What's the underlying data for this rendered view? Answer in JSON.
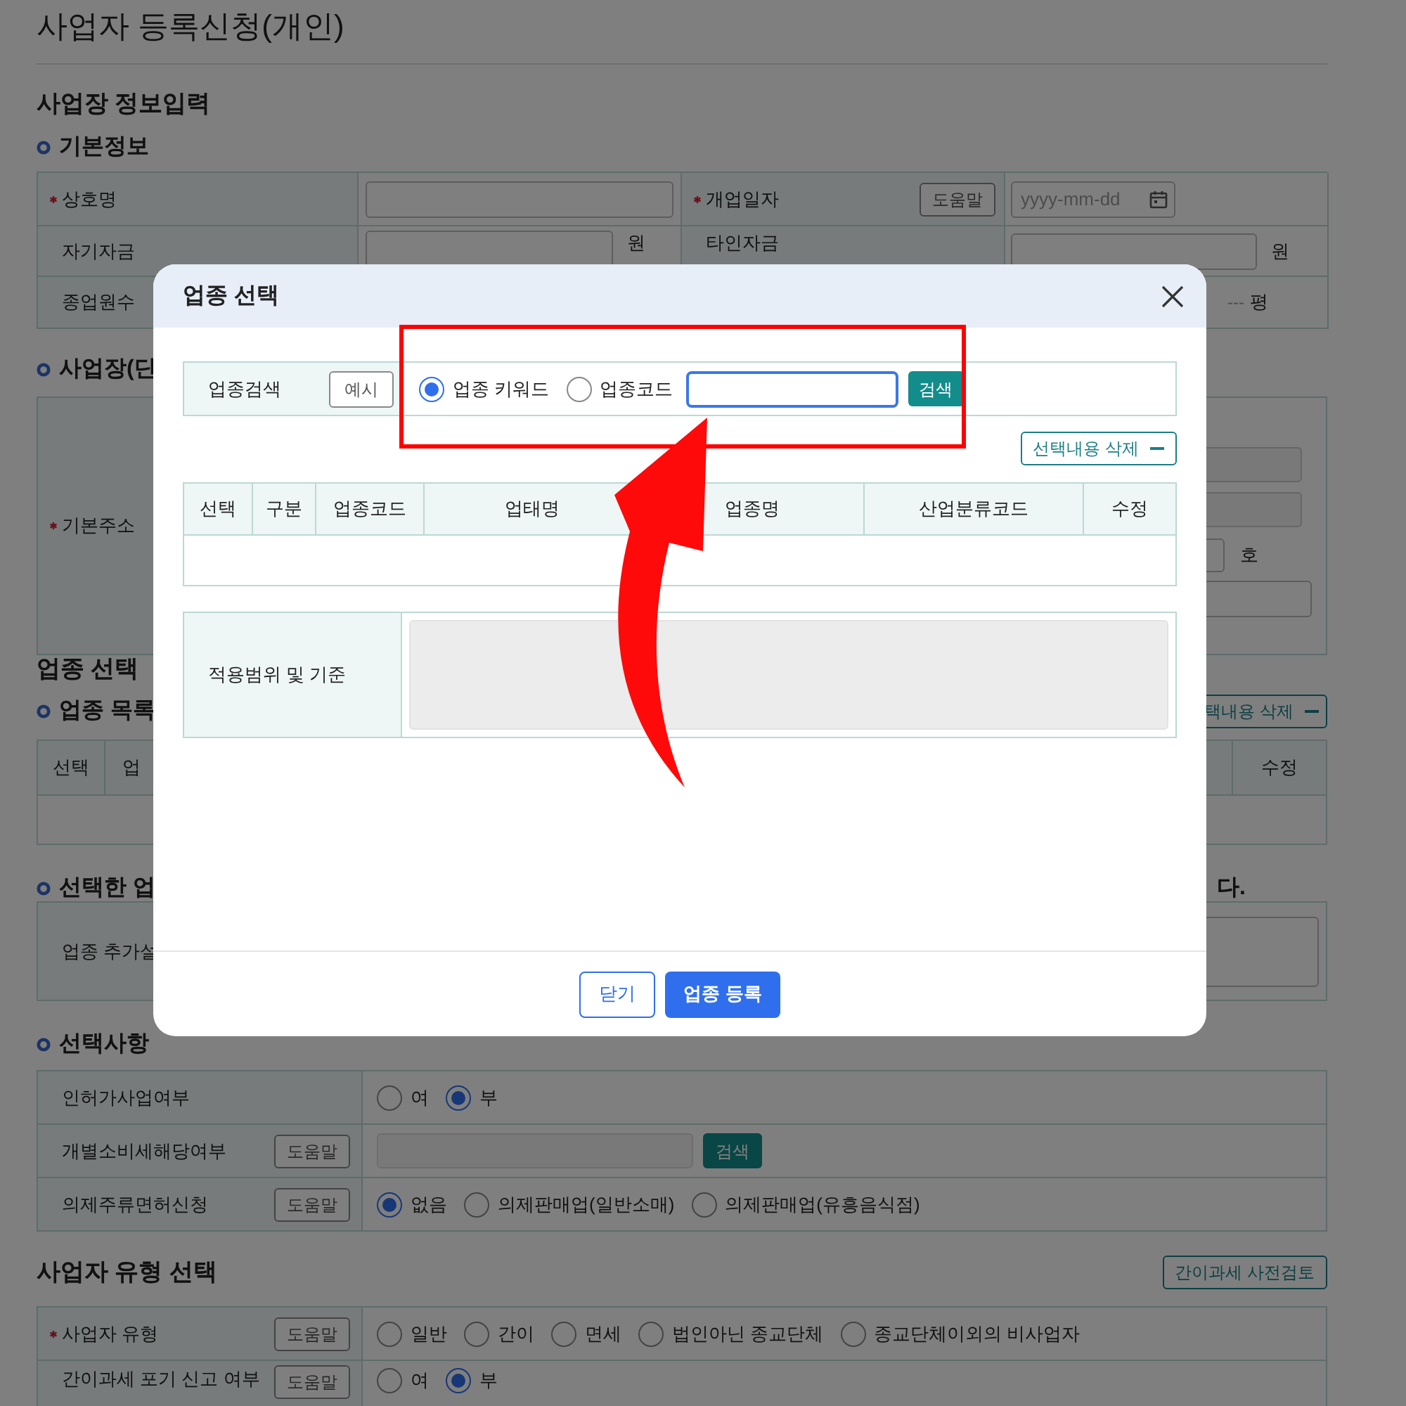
{
  "page_title": "사업자 등록신청(개인)",
  "basic_info": {
    "heading": "사업장 정보입력",
    "subheading": "기본정보",
    "trade_name": {
      "label": "상호명",
      "required": true
    },
    "opening_date": {
      "label": "개업일자",
      "required": true,
      "help_button": "도움말",
      "placeholder": "yyyy-mm-dd"
    },
    "own_capital": {
      "label": "자기자금",
      "unit": "원"
    },
    "other_capital": {
      "label": "타인자금",
      "unit": "원"
    },
    "employees": {
      "label": "종업원수"
    },
    "area": {
      "placeholder": "---",
      "unit": "평"
    }
  },
  "site_address": {
    "subheading": "사업장(단",
    "label": "기본주소",
    "required": true,
    "unit": "호"
  },
  "industry": {
    "heading": "업종 선택",
    "list_heading": "업종 목록",
    "delete_button": "택내용 삭제",
    "columns": [
      "선택",
      "업",
      "수정"
    ],
    "note_start": "선택한 업",
    "note_end": "다.",
    "extra_label": "업종 추가설"
  },
  "options": {
    "heading": "선택사항",
    "rows": [
      {
        "kind": "radio",
        "label": "인허가사업여부",
        "options": [
          {
            "label": "여",
            "selected": false
          },
          {
            "label": "부",
            "selected": true
          }
        ]
      },
      {
        "kind": "search",
        "label": "개별소비세해당여부",
        "help_button": "도움말",
        "search_button": "검색"
      },
      {
        "kind": "radio",
        "label": "의제주류면허신청",
        "help_button": "도움말",
        "options": [
          {
            "label": "없음",
            "selected": true
          },
          {
            "label": "의제판매업(일반소매)",
            "selected": false
          },
          {
            "label": "의제판매업(유흥음식점)",
            "selected": false
          }
        ]
      }
    ]
  },
  "business_type": {
    "heading": "사업자 유형 선택",
    "review_button": "간이과세 사전검토",
    "rows": [
      {
        "kind": "radio",
        "label": "사업자 유형",
        "required": true,
        "help_button": "도움말",
        "options": [
          {
            "label": "일반",
            "selected": false
          },
          {
            "label": "간이",
            "selected": false
          },
          {
            "label": "면세",
            "selected": false
          },
          {
            "label": "법인아닌 종교단체",
            "selected": false
          },
          {
            "label": "종교단체이외의 비사업자",
            "selected": false
          }
        ]
      },
      {
        "kind": "radio",
        "label": "간이과세 포기 신고 여부",
        "help_button": "도움말",
        "options": [
          {
            "label": "여",
            "selected": false
          },
          {
            "label": "부",
            "selected": true
          }
        ]
      }
    ]
  },
  "modal": {
    "title": "업종 선택",
    "search": {
      "label": "업종검색",
      "example_button": "예시",
      "modes": [
        {
          "label": "업종 키워드",
          "selected": true
        },
        {
          "label": "업종코드",
          "selected": false
        }
      ],
      "search_button": "검색"
    },
    "delete_button": "선택내용 삭제",
    "columns": [
      "선택",
      "구분",
      "업종코드",
      "업태명",
      "업종명",
      "산업분류코드",
      "수정"
    ],
    "criteria_label": "적용범위 및 기준",
    "buttons": [
      {
        "label": "닫기",
        "kind": "secondary"
      },
      {
        "label": "업종 등록",
        "kind": "primary"
      }
    ]
  }
}
